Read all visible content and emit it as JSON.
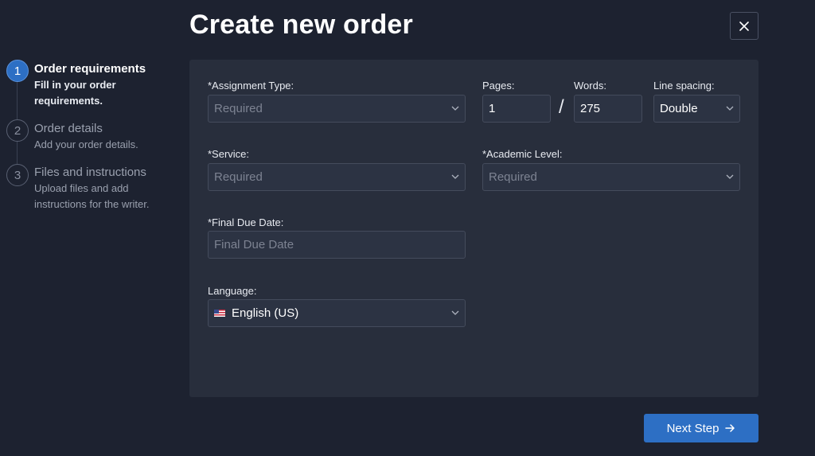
{
  "header": {
    "title": "Create new order",
    "close_icon": "close-icon"
  },
  "steps": [
    {
      "number": "1",
      "title": "Order requirements",
      "description": "Fill in your order requirements.",
      "state": "active"
    },
    {
      "number": "2",
      "title": "Order details",
      "description": "Add your order details.",
      "state": "inactive"
    },
    {
      "number": "3",
      "title": "Files and instructions",
      "description": "Upload files and add instructions for the writer.",
      "state": "inactive"
    }
  ],
  "form": {
    "assignment_type": {
      "label": "*Assignment Type:",
      "placeholder": "Required"
    },
    "pages": {
      "label": "Pages:",
      "value": "1"
    },
    "separator": "/",
    "words": {
      "label": "Words:",
      "value": "275"
    },
    "line_spacing": {
      "label": "Line spacing:",
      "value": "Double"
    },
    "service": {
      "label": "*Service:",
      "placeholder": "Required"
    },
    "academic_level": {
      "label": "*Academic Level:",
      "placeholder": "Required"
    },
    "final_due_date": {
      "label": "*Final Due Date:",
      "placeholder": "Final Due Date"
    },
    "language": {
      "label": "Language:",
      "value": "English (US)",
      "flag": "us-flag-icon"
    }
  },
  "footer": {
    "next_label": "Next Step",
    "next_icon": "arrow-right-icon"
  },
  "colors": {
    "background": "#1d2230",
    "panel": "#282e3c",
    "accent": "#2d6fc4"
  }
}
